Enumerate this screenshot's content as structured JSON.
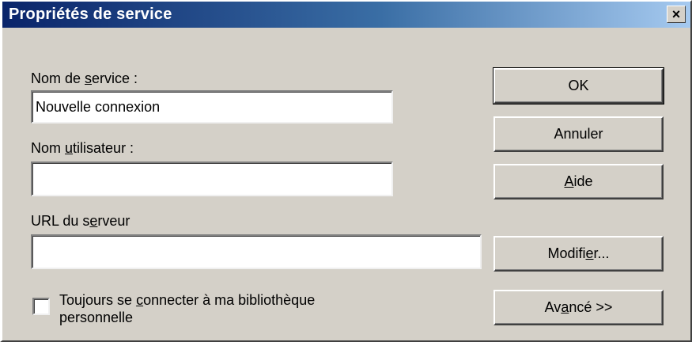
{
  "window": {
    "title": "Propriétés de service",
    "close_glyph": "×"
  },
  "form": {
    "service_name": {
      "label_pre": "Nom de ",
      "label_mnemonic": "s",
      "label_post": "ervice :",
      "value": "Nouvelle connexion"
    },
    "username": {
      "label_pre": "Nom ",
      "label_mnemonic": "u",
      "label_post": "tilisateur :",
      "value": ""
    },
    "server_url": {
      "label_pre": "URL du s",
      "label_mnemonic": "e",
      "label_post": "rveur",
      "value": ""
    },
    "always_connect": {
      "label_pre": "Toujours se ",
      "label_mnemonic": "c",
      "label_post": "onnecter à ma bibliothèque",
      "label_line2": "personnelle",
      "checked": false
    }
  },
  "buttons": {
    "ok": "OK",
    "cancel": "Annuler",
    "help_mnemonic": "A",
    "help_post": "ide",
    "modify_pre": "Modifi",
    "modify_mnemonic": "e",
    "modify_post": "r...",
    "advanced_pre": "Av",
    "advanced_mnemonic": "a",
    "advanced_post": "ncé >>"
  }
}
